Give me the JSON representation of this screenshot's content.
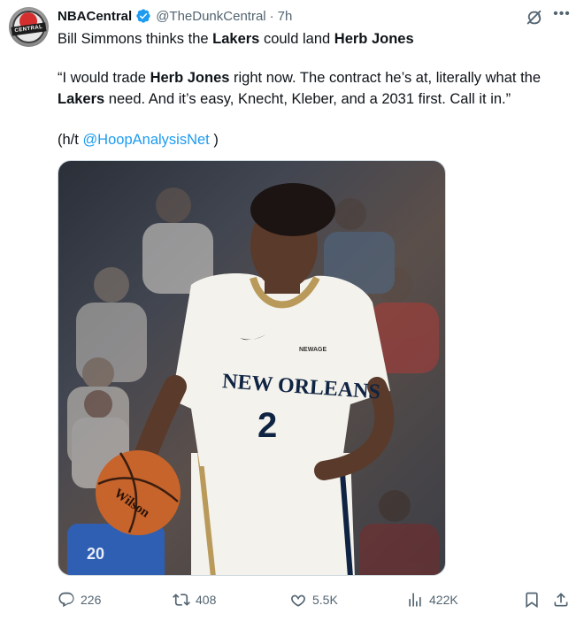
{
  "account": {
    "avatar_text": "CENTRAL",
    "display_name": "NBACentral",
    "handle": "@TheDunkCentral",
    "separator": "·",
    "time": "7h",
    "verified_color": "#1d9bf0"
  },
  "tweet": {
    "line1_pre": "Bill Simmons thinks the ",
    "line1_b1": "Lakers",
    "line1_mid": " could land ",
    "line1_b2": "Herb Jones",
    "quote_p1": "“I would trade ",
    "quote_b1": "Herb Jones",
    "quote_p2": " right now. The contract he’s at, literally what the ",
    "quote_b2": "Lakers",
    "quote_p3": " need. And it’s easy, Knecht, Kleber, and a 2031 first. Call it in.”",
    "ht_pre": "(h/t ",
    "ht_link": "@HoopAnalysisNet",
    "ht_post": " )"
  },
  "media": {
    "jersey_text": "NEW ORLEANS",
    "jersey_number": "2",
    "sponsor_text": "NEWAGE",
    "ball_text": "Wilson",
    "fan_number": "20"
  },
  "actions": {
    "replies": "226",
    "reposts": "408",
    "likes": "5.5K",
    "views": "422K"
  },
  "colors": {
    "text_primary": "#0f1419",
    "text_secondary": "#536471",
    "link": "#1d9bf0",
    "jersey": "#f4f2ec",
    "jersey_trim": "#b99a5b",
    "jersey_number": "#0f2342"
  },
  "icons": {
    "verified": "verified-badge-icon",
    "grok": "grok-icon",
    "more": "more-icon",
    "reply": "reply-icon",
    "repost": "repost-icon",
    "like": "heart-icon",
    "views": "views-icon",
    "bookmark": "bookmark-icon",
    "share": "share-icon"
  }
}
